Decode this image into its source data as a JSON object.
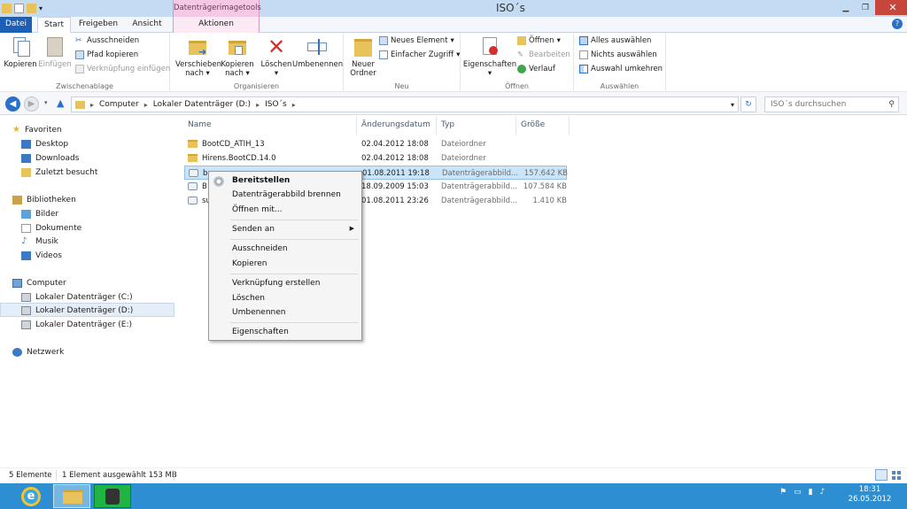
{
  "window": {
    "title": "ISO´s",
    "contextual_tab_group": "Datenträgerimagetools"
  },
  "tabs": {
    "file": "Datei",
    "home": "Start",
    "share": "Freigeben",
    "view": "Ansicht",
    "actions": "Aktionen"
  },
  "ribbon": {
    "clipboard": {
      "label": "Zwischenablage",
      "copy": "Kopieren",
      "paste": "Einfügen",
      "cut": "Ausschneiden",
      "copy_path": "Pfad kopieren",
      "paste_shortcut": "Verknüpfung einfügen"
    },
    "organize": {
      "label": "Organisieren",
      "move_to_line1": "Verschieben",
      "move_to_line2": "nach",
      "copy_to_line1": "Kopieren",
      "copy_to_line2": "nach",
      "delete": "Löschen",
      "rename": "Umbenennen"
    },
    "new": {
      "label": "Neu",
      "new_folder_line1": "Neuer",
      "new_folder_line2": "Ordner",
      "new_item": "Neues Element",
      "easy_access": "Einfacher Zugriff"
    },
    "open": {
      "label": "Öffnen",
      "properties": "Eigenschaften",
      "open": "Öffnen",
      "edit": "Bearbeiten",
      "history": "Verlauf"
    },
    "select": {
      "label": "Auswählen",
      "select_all": "Alles auswählen",
      "select_none": "Nichts auswählen",
      "invert": "Auswahl umkehren"
    }
  },
  "address": {
    "crumbs": [
      "Computer",
      "Lokaler Datenträger (D:)",
      "ISO´s"
    ],
    "search_placeholder": "ISO´s durchsuchen"
  },
  "nav": {
    "favorites": "Favoriten",
    "desktop": "Desktop",
    "downloads": "Downloads",
    "recent": "Zuletzt besucht",
    "libraries": "Bibliotheken",
    "pictures": "Bilder",
    "documents": "Dokumente",
    "music": "Musik",
    "videos": "Videos",
    "computer": "Computer",
    "drive_c": "Lokaler Datenträger (C:)",
    "drive_d": "Lokaler Datenträger (D:)",
    "drive_e": "Lokaler Datenträger (E:)",
    "network": "Netzwerk"
  },
  "columns": {
    "name": "Name",
    "date": "Änderungsdatum",
    "type": "Typ",
    "size": "Größe"
  },
  "files": [
    {
      "name": "BootCD_ATIH_13",
      "date": "02.04.2012 18:08",
      "type": "Dateiordner",
      "size": ""
    },
    {
      "name": "Hirens.BootCD.14.0",
      "date": "02.04.2012 18:08",
      "type": "Dateiordner",
      "size": ""
    },
    {
      "name": "b",
      "date": "01.08.2011 19:18",
      "type": "Datenträgerabbild...",
      "size": "157.642 KB"
    },
    {
      "name": "B",
      "date": "18.09.2009 15:03",
      "type": "Datenträgerabbild...",
      "size": "107.584 KB"
    },
    {
      "name": "su",
      "date": "01.08.2011 23:26",
      "type": "Datenträgerabbild...",
      "size": "1.410 KB"
    }
  ],
  "context_menu": {
    "mount": "Bereitstellen",
    "burn": "Datenträgerabbild brennen",
    "open_with": "Öffnen mit...",
    "send_to": "Senden an",
    "cut": "Ausschneiden",
    "copy": "Kopieren",
    "create_shortcut": "Verknüpfung erstellen",
    "delete": "Löschen",
    "rename": "Umbenennen",
    "properties": "Eigenschaften"
  },
  "status": {
    "count": "5 Elemente",
    "selection": "1 Element ausgewählt  153 MB"
  },
  "clock": {
    "time": "18:31",
    "date": "26.05.2012"
  },
  "colors": {
    "accent": "#1b5fb7",
    "taskbar": "#2d8fd1",
    "contextual": "#f5c8e6",
    "selection": "#cce4f7"
  }
}
